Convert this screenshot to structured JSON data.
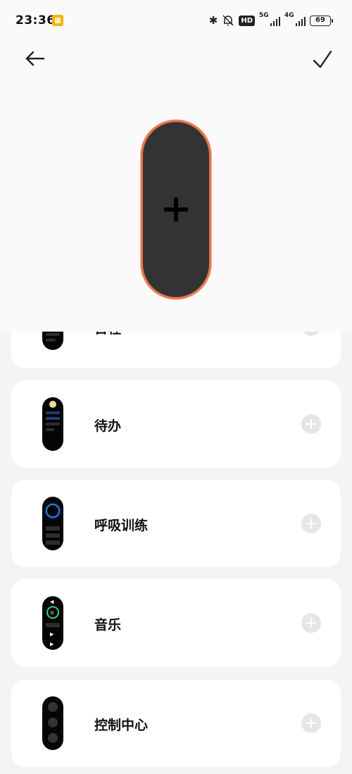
{
  "status_bar": {
    "time": "23:36",
    "hd_label": "HD",
    "net1_label": "5G",
    "net2_label": "4G",
    "battery": "69"
  },
  "header": {
    "back_icon": "arrow-left-icon",
    "confirm_icon": "check-icon",
    "preview_add_icon": "plus-icon"
  },
  "cards": [
    {
      "label": "日程",
      "icon": "schedule-band-icon"
    },
    {
      "label": "待办",
      "icon": "todo-band-icon"
    },
    {
      "label": "呼吸训练",
      "icon": "breathing-band-icon"
    },
    {
      "label": "音乐",
      "icon": "music-band-icon"
    },
    {
      "label": "控制中心",
      "icon": "control-center-band-icon"
    }
  ],
  "colors": {
    "accent_border": "#e8734a",
    "band_body": "#333333",
    "add_button": "#e6e6e6",
    "page_background": "#f4f4f4"
  }
}
